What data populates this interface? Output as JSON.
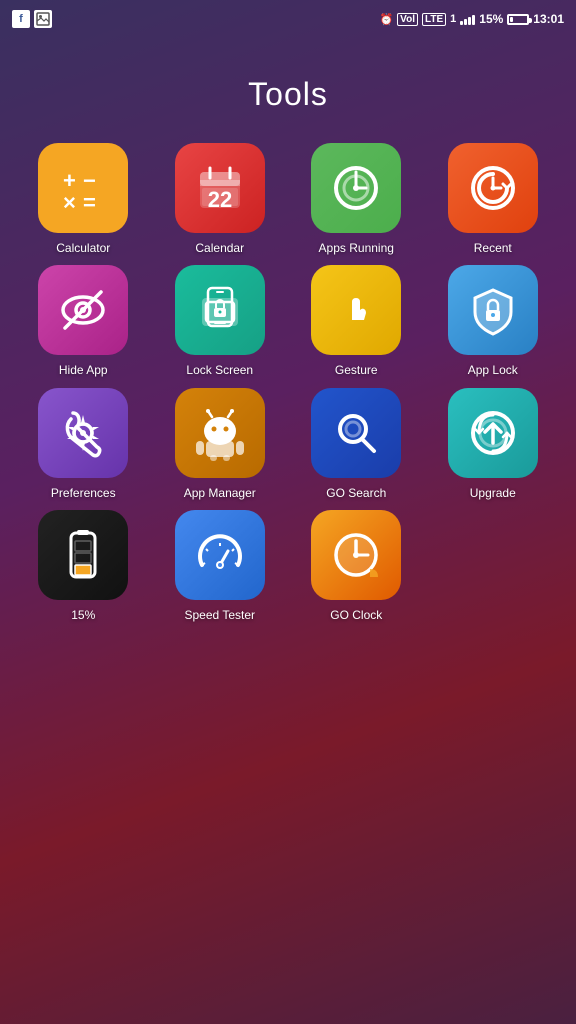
{
  "statusBar": {
    "alarm": "⏰",
    "volte": "VoLTE",
    "lte1": "LTE 1",
    "signal": "signal",
    "battery_percent": "15%",
    "time": "13:01"
  },
  "pageTitle": "Tools",
  "apps": [
    {
      "id": "calculator",
      "label": "Calculator",
      "iconClass": "icon-calculator",
      "iconType": "calculator"
    },
    {
      "id": "calendar",
      "label": "Calendar",
      "iconClass": "icon-calendar",
      "iconType": "calendar"
    },
    {
      "id": "apps-running",
      "label": "Apps Running",
      "iconClass": "icon-apps-running",
      "iconType": "apps-running"
    },
    {
      "id": "recent",
      "label": "Recent",
      "iconClass": "icon-recent",
      "iconType": "recent"
    },
    {
      "id": "hide-app",
      "label": "Hide App",
      "iconClass": "icon-hide-app",
      "iconType": "hide-app"
    },
    {
      "id": "lock-screen",
      "label": "Lock Screen",
      "iconClass": "icon-lock-screen",
      "iconType": "lock-screen"
    },
    {
      "id": "gesture",
      "label": "Gesture",
      "iconClass": "icon-gesture",
      "iconType": "gesture"
    },
    {
      "id": "app-lock",
      "label": "App Lock",
      "iconClass": "icon-app-lock",
      "iconType": "app-lock"
    },
    {
      "id": "preferences",
      "label": "Preferences",
      "iconClass": "icon-preferences",
      "iconType": "preferences"
    },
    {
      "id": "app-manager",
      "label": "App Manager",
      "iconClass": "icon-app-manager",
      "iconType": "app-manager"
    },
    {
      "id": "go-search",
      "label": "GO Search",
      "iconClass": "icon-go-search",
      "iconType": "go-search"
    },
    {
      "id": "upgrade",
      "label": "Upgrade",
      "iconClass": "icon-upgrade",
      "iconType": "upgrade"
    },
    {
      "id": "battery-15",
      "label": "15%",
      "iconClass": "icon-battery",
      "iconType": "battery"
    },
    {
      "id": "speed-tester",
      "label": "Speed Tester",
      "iconClass": "icon-speed-tester",
      "iconType": "speed-tester"
    },
    {
      "id": "go-clock",
      "label": "GO Clock",
      "iconClass": "icon-go-clock",
      "iconType": "go-clock"
    }
  ]
}
